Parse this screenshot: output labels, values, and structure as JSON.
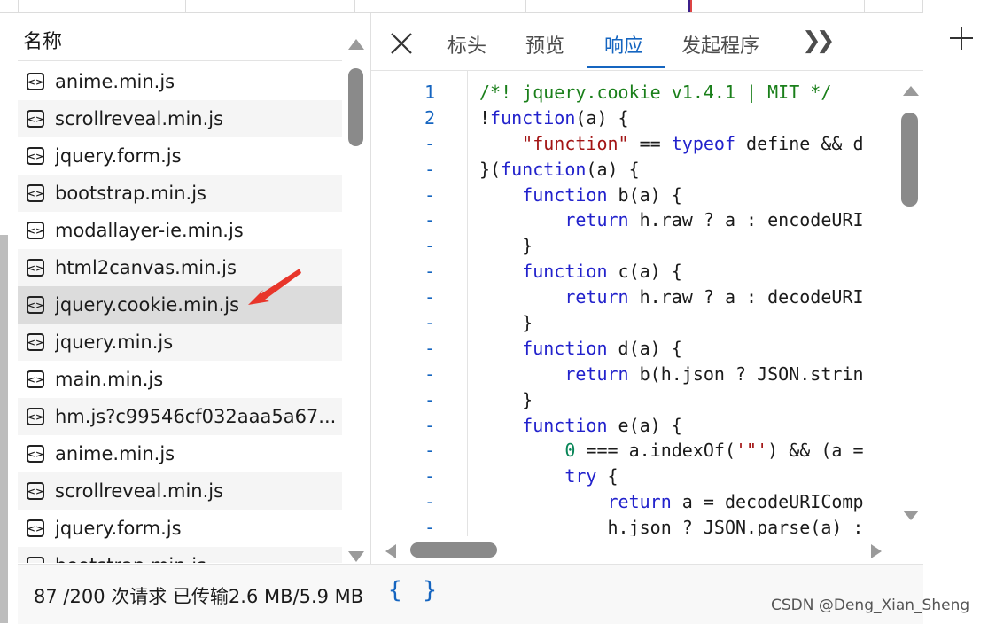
{
  "header": {
    "name_column": "名称"
  },
  "requests": [
    {
      "name": "anime.min.js",
      "selected": false
    },
    {
      "name": "scrollreveal.min.js",
      "selected": false
    },
    {
      "name": "jquery.form.js",
      "selected": false
    },
    {
      "name": "bootstrap.min.js",
      "selected": false
    },
    {
      "name": "modallayer-ie.min.js",
      "selected": false
    },
    {
      "name": "html2canvas.min.js",
      "selected": false
    },
    {
      "name": "jquery.cookie.min.js",
      "selected": true
    },
    {
      "name": "jquery.min.js",
      "selected": false
    },
    {
      "name": "main.min.js",
      "selected": false
    },
    {
      "name": "hm.js?c99546cf032aaa5a67...",
      "selected": false
    },
    {
      "name": "anime.min.js",
      "selected": false
    },
    {
      "name": "scrollreveal.min.js",
      "selected": false
    },
    {
      "name": "jquery.form.js",
      "selected": false
    },
    {
      "name": "bootstrap.min.js",
      "selected": false
    }
  ],
  "tabs": [
    {
      "label": "标头",
      "active": false
    },
    {
      "label": "预览",
      "active": false
    },
    {
      "label": "响应",
      "active": true
    },
    {
      "label": "发起程序",
      "active": false
    }
  ],
  "code": [
    {
      "ln": "1",
      "tokens": [
        [
          "c-com",
          "/*! jquery.cookie v1.4.1 | MIT */"
        ]
      ]
    },
    {
      "ln": "2",
      "tokens": [
        [
          "c-plain",
          "!"
        ],
        [
          "c-kw",
          "function"
        ],
        [
          "c-plain",
          "(a) {"
        ]
      ]
    },
    {
      "ln": "-",
      "tokens": [
        [
          "c-plain",
          "    "
        ],
        [
          "c-str",
          "\"function\""
        ],
        [
          "c-plain",
          " == "
        ],
        [
          "c-kw",
          "typeof"
        ],
        [
          "c-plain",
          " define && d"
        ]
      ]
    },
    {
      "ln": "-",
      "tokens": [
        [
          "c-plain",
          "}("
        ],
        [
          "c-kw",
          "function"
        ],
        [
          "c-plain",
          "(a) {"
        ]
      ]
    },
    {
      "ln": "-",
      "tokens": [
        [
          "c-plain",
          "    "
        ],
        [
          "c-kw",
          "function"
        ],
        [
          "c-plain",
          " b(a) {"
        ]
      ]
    },
    {
      "ln": "-",
      "tokens": [
        [
          "c-plain",
          "        "
        ],
        [
          "c-kw",
          "return"
        ],
        [
          "c-plain",
          " h.raw ? a : encodeURI"
        ]
      ]
    },
    {
      "ln": "-",
      "tokens": [
        [
          "c-plain",
          "    }"
        ]
      ]
    },
    {
      "ln": "-",
      "tokens": [
        [
          "c-plain",
          "    "
        ],
        [
          "c-kw",
          "function"
        ],
        [
          "c-plain",
          " c(a) {"
        ]
      ]
    },
    {
      "ln": "-",
      "tokens": [
        [
          "c-plain",
          "        "
        ],
        [
          "c-kw",
          "return"
        ],
        [
          "c-plain",
          " h.raw ? a : decodeURI"
        ]
      ]
    },
    {
      "ln": "-",
      "tokens": [
        [
          "c-plain",
          "    }"
        ]
      ]
    },
    {
      "ln": "-",
      "tokens": [
        [
          "c-plain",
          "    "
        ],
        [
          "c-kw",
          "function"
        ],
        [
          "c-plain",
          " d(a) {"
        ]
      ]
    },
    {
      "ln": "-",
      "tokens": [
        [
          "c-plain",
          "        "
        ],
        [
          "c-kw",
          "return"
        ],
        [
          "c-plain",
          " b(h.json ? JSON.strin"
        ]
      ]
    },
    {
      "ln": "-",
      "tokens": [
        [
          "c-plain",
          "    }"
        ]
      ]
    },
    {
      "ln": "-",
      "tokens": [
        [
          "c-plain",
          "    "
        ],
        [
          "c-kw",
          "function"
        ],
        [
          "c-plain",
          " e(a) {"
        ]
      ]
    },
    {
      "ln": "-",
      "tokens": [
        [
          "c-plain",
          "        "
        ],
        [
          "c-num",
          "0"
        ],
        [
          "c-plain",
          " === a.indexOf("
        ],
        [
          "c-str",
          "'\"'"
        ],
        [
          "c-plain",
          ") && (a ="
        ]
      ]
    },
    {
      "ln": "-",
      "tokens": [
        [
          "c-plain",
          "        "
        ],
        [
          "c-kw",
          "try"
        ],
        [
          "c-plain",
          " {"
        ]
      ]
    },
    {
      "ln": "-",
      "tokens": [
        [
          "c-plain",
          "            "
        ],
        [
          "c-kw",
          "return"
        ],
        [
          "c-plain",
          " a = decodeURIComp"
        ]
      ]
    },
    {
      "ln": "-",
      "tokens": [
        [
          "c-plain",
          "            h.json ? JSON.parse(a) :"
        ]
      ]
    }
  ],
  "status": {
    "summary": "87 /200 次请求  已传输2.6 MB/5.9 MB",
    "pretty_print": "{ }"
  },
  "watermark": "CSDN @Deng_Xian_Sheng",
  "colors": {
    "accent": "#1565c0",
    "selected_row": "#dcdcdc",
    "annotation": "#e8362b"
  },
  "icons": {
    "close": "close-icon",
    "more": "chevron-double-right-icon",
    "add": "plus-icon",
    "file": "js-file-icon"
  }
}
